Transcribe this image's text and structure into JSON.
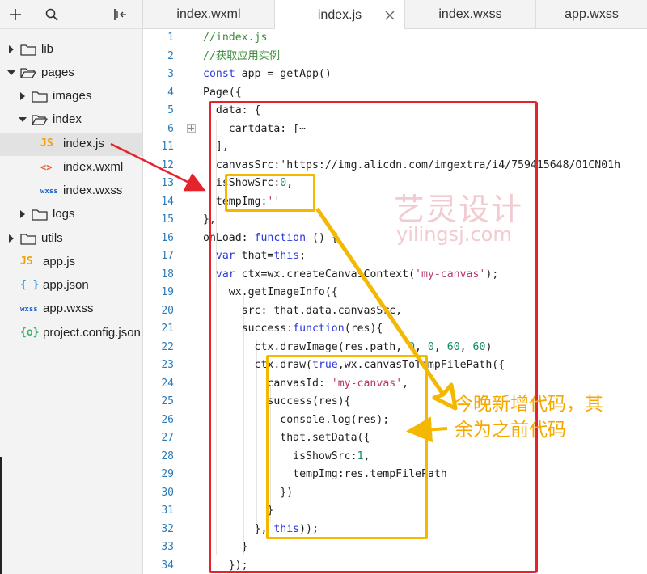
{
  "sidebar": {
    "toolbar": {
      "add_icon": "plus-icon",
      "search_icon": "search-icon",
      "collapse_icon": "collapse-panel-icon"
    },
    "tree": [
      {
        "label": "lib",
        "type": "folder",
        "state": "collapsed"
      },
      {
        "label": "pages",
        "type": "folder",
        "state": "expanded"
      },
      {
        "label": "images",
        "type": "folder",
        "state": "collapsed"
      },
      {
        "label": "index",
        "type": "folder",
        "state": "expanded"
      },
      {
        "label": "index.js",
        "type": "js",
        "badge": "JS",
        "selected": true
      },
      {
        "label": "index.wxml",
        "type": "wxml",
        "badge": "<>"
      },
      {
        "label": "index.wxss",
        "type": "wxss",
        "badge": "wxss"
      },
      {
        "label": "logs",
        "type": "folder",
        "state": "collapsed"
      },
      {
        "label": "utils",
        "type": "folder",
        "state": "collapsed"
      },
      {
        "label": "app.js",
        "type": "js",
        "badge": "JS"
      },
      {
        "label": "app.json",
        "type": "json",
        "badge": "{ }"
      },
      {
        "label": "app.wxss",
        "type": "wxss",
        "badge": "wxss"
      },
      {
        "label": "project.config.json",
        "type": "config",
        "badge": "{o}"
      }
    ]
  },
  "tabs": [
    {
      "label": "index.wxml",
      "active": false
    },
    {
      "label": "index.js",
      "active": true
    },
    {
      "label": "index.wxss",
      "active": false
    },
    {
      "label": "app.wxss",
      "active": false
    }
  ],
  "editor": {
    "lines": [
      {
        "n": "1",
        "text": "//index.js"
      },
      {
        "n": "2",
        "text": "//获取应用实例"
      },
      {
        "n": "3",
        "text": "const app = getApp()"
      },
      {
        "n": "4",
        "text": "Page({"
      },
      {
        "n": "5",
        "text": "  data: {"
      },
      {
        "n": "6",
        "text": "    cartdata: [⋯"
      },
      {
        "n": "11",
        "text": "  ],"
      },
      {
        "n": "12",
        "text": "  canvasSrc:'https://img.alicdn.com/imgextra/i4/759415648/O1CN01h"
      },
      {
        "n": "13",
        "text": "  isShowSrc:0,"
      },
      {
        "n": "14",
        "text": "  tempImg:''"
      },
      {
        "n": "15",
        "text": "},"
      },
      {
        "n": "16",
        "text": "onLoad: function () {"
      },
      {
        "n": "17",
        "text": "  var that=this;"
      },
      {
        "n": "18",
        "text": "  var ctx=wx.createCanvasContext('my-canvas');"
      },
      {
        "n": "19",
        "text": "    wx.getImageInfo({"
      },
      {
        "n": "20",
        "text": "      src: that.data.canvasSrc,"
      },
      {
        "n": "21",
        "text": "      success:function(res){"
      },
      {
        "n": "22",
        "text": "        ctx.drawImage(res.path, 0, 0, 60, 60)"
      },
      {
        "n": "23",
        "text": "        ctx.draw(true,wx.canvasToTempFilePath({"
      },
      {
        "n": "24",
        "text": "          canvasId: 'my-canvas',"
      },
      {
        "n": "25",
        "text": "          success(res){"
      },
      {
        "n": "26",
        "text": "            console.log(res);"
      },
      {
        "n": "27",
        "text": "            that.setData({"
      },
      {
        "n": "28",
        "text": "              isShowSrc:1,"
      },
      {
        "n": "29",
        "text": "              tempImg:res.tempFilePath"
      },
      {
        "n": "30",
        "text": "            })"
      },
      {
        "n": "31",
        "text": "          }"
      },
      {
        "n": "32",
        "text": "        }, this));"
      },
      {
        "n": "33",
        "text": "      }"
      },
      {
        "n": "34",
        "text": "    });"
      }
    ]
  },
  "annotations": {
    "watermark_cn": "艺灵设计",
    "watermark_en": "yilingsj.com",
    "callout_line1": "今晚新增代码，其",
    "callout_line2": "余为之前代码",
    "red_color": "#e4232c",
    "yellow_color": "#f5b800"
  }
}
